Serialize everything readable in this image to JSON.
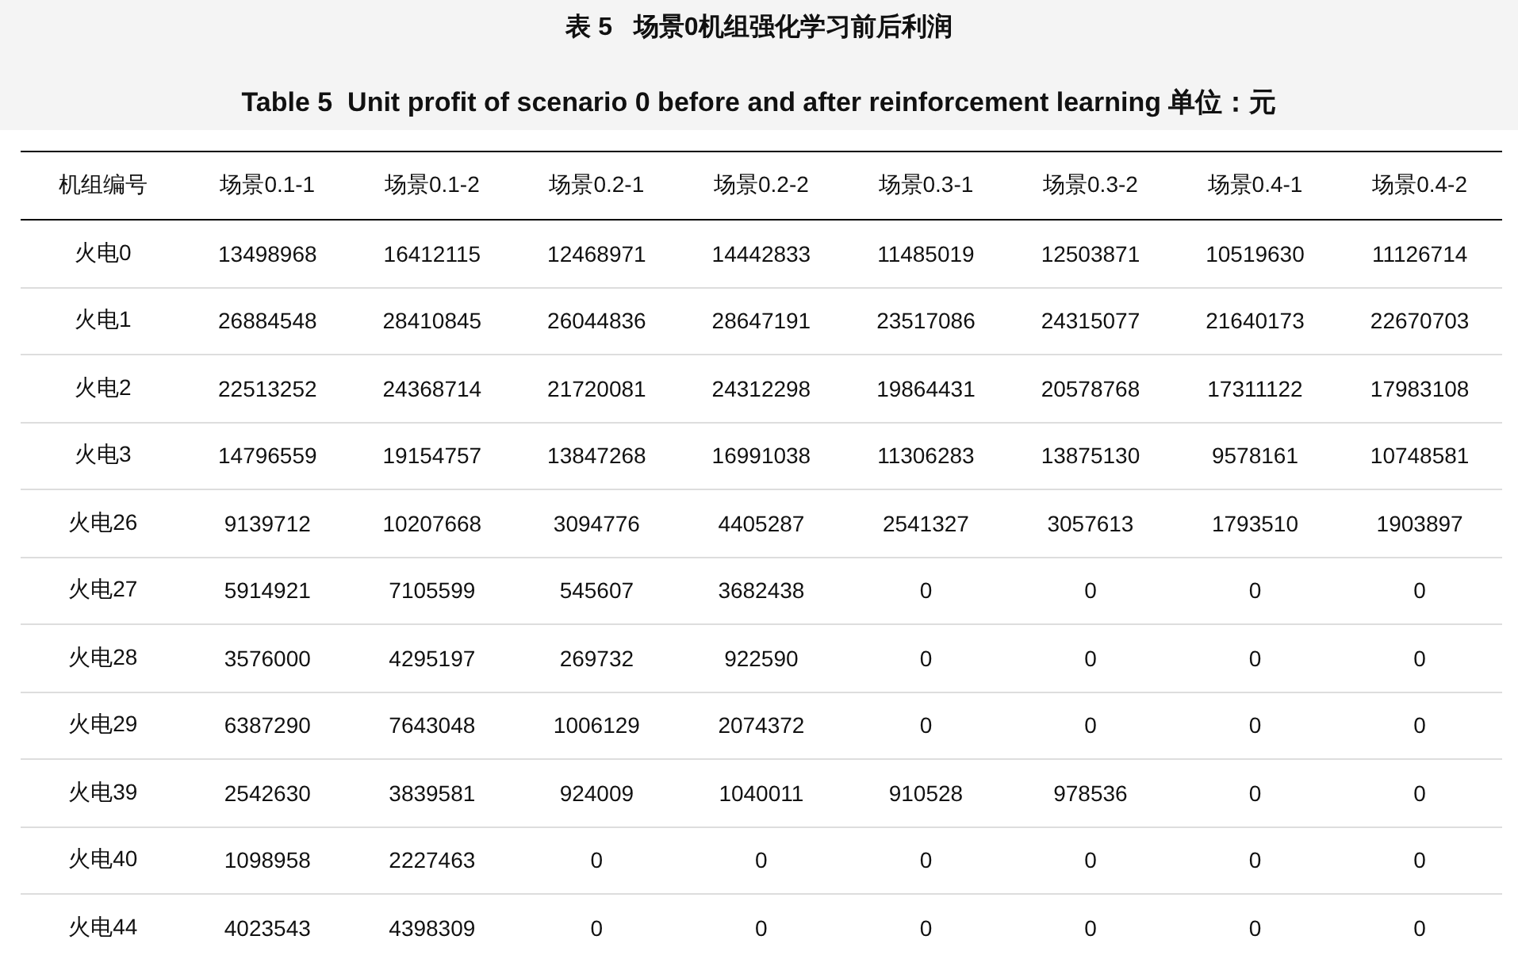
{
  "caption": {
    "title_zh": "表 5   场景0机组强化学习前后利润",
    "title_en": "Table 5  Unit profit of scenario 0 before and after reinforcement learning 单位：元"
  },
  "table": {
    "columns": [
      "机组编号",
      "场景0.1-1",
      "场景0.1-2",
      "场景0.2-1",
      "场景0.2-2",
      "场景0.3-1",
      "场景0.3-2",
      "场景0.4-1",
      "场景0.4-2"
    ],
    "rows": [
      [
        "火电0",
        "13498968",
        "16412115",
        "12468971",
        "14442833",
        "11485019",
        "12503871",
        "10519630",
        "11126714"
      ],
      [
        "火电1",
        "26884548",
        "28410845",
        "26044836",
        "28647191",
        "23517086",
        "24315077",
        "21640173",
        "22670703"
      ],
      [
        "火电2",
        "22513252",
        "24368714",
        "21720081",
        "24312298",
        "19864431",
        "20578768",
        "17311122",
        "17983108"
      ],
      [
        "火电3",
        "14796559",
        "19154757",
        "13847268",
        "16991038",
        "11306283",
        "13875130",
        "9578161",
        "10748581"
      ],
      [
        "火电26",
        "9139712",
        "10207668",
        "3094776",
        "4405287",
        "2541327",
        "3057613",
        "1793510",
        "1903897"
      ],
      [
        "火电27",
        "5914921",
        "7105599",
        "545607",
        "3682438",
        "0",
        "0",
        "0",
        "0"
      ],
      [
        "火电28",
        "3576000",
        "4295197",
        "269732",
        "922590",
        "0",
        "0",
        "0",
        "0"
      ],
      [
        "火电29",
        "6387290",
        "7643048",
        "1006129",
        "2074372",
        "0",
        "0",
        "0",
        "0"
      ],
      [
        "火电39",
        "2542630",
        "3839581",
        "924009",
        "1040011",
        "910528",
        "978536",
        "0",
        "0"
      ],
      [
        "火电40",
        "1098958",
        "2227463",
        "0",
        "0",
        "0",
        "0",
        "0",
        "0"
      ],
      [
        "火电44",
        "4023543",
        "4398309",
        "0",
        "0",
        "0",
        "0",
        "0",
        "0"
      ]
    ]
  }
}
